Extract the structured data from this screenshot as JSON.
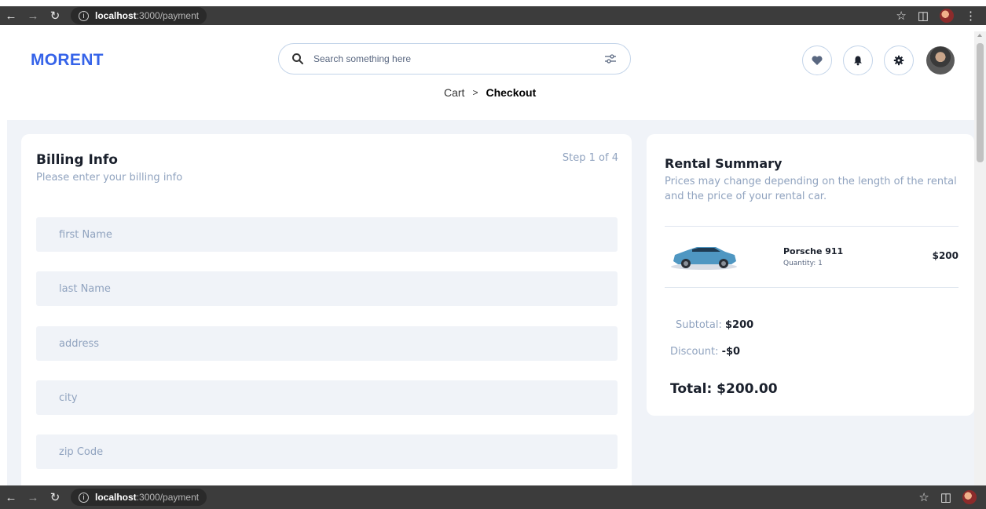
{
  "browser": {
    "url_host": "localhost",
    "url_path": ":3000/payment"
  },
  "header": {
    "logo": "MORENT",
    "search_placeholder": "Search something here",
    "icons": [
      "heart-icon",
      "bell-icon",
      "gear-icon"
    ]
  },
  "breadcrumb": {
    "parent": "Cart",
    "separator": ">",
    "current": "Checkout"
  },
  "billing": {
    "title": "Billing Info",
    "subtitle": "Please enter your billing info",
    "step": "Step 1 of 4",
    "fields": [
      {
        "placeholder": "first Name"
      },
      {
        "placeholder": "last Name"
      },
      {
        "placeholder": "address"
      },
      {
        "placeholder": "city"
      },
      {
        "placeholder": "zip Code"
      }
    ]
  },
  "summary": {
    "title": "Rental Summary",
    "description": "Prices may change depending on the length of the rental and the price of your rental car.",
    "item": {
      "name": "Porsche 911",
      "quantity": "Quantity: 1",
      "price": "$200"
    },
    "subtotal_label": "Subtotal:",
    "subtotal_value": "$200",
    "discount_label": "Discount:",
    "discount_value": "-$0",
    "total": "Total: $200.00"
  },
  "colors": {
    "brand": "#3563e9",
    "background": "#f0f3f8",
    "muted_text": "#90a3bf"
  }
}
